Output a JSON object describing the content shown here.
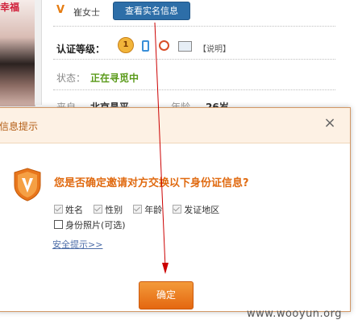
{
  "profile": {
    "photo_caption": "幸福",
    "badge": "V",
    "name": "崔女士",
    "view_button": "查看实名信息",
    "level_label": "认证等级：",
    "medal_value": "1",
    "explain_link": "【说明】",
    "status_label": "状态：",
    "status_value": "正在寻觅中",
    "origin_label": "来自",
    "origin_value": "北京昌平",
    "age_label": "年龄",
    "age_value": "26岁"
  },
  "dialog": {
    "title": "信息提示",
    "close": "×",
    "question": "您是否确定邀请对方交换以下身份证信息?",
    "options": [
      "姓名",
      "性别",
      "年龄",
      "发证地区"
    ],
    "photo_option": "身份照片(可选)",
    "safety_link": "安全提示>>",
    "confirm": "确定"
  },
  "watermark": "www.wooyun.org",
  "colors": {
    "accent_orange": "#e46710",
    "link_blue": "#2d6ea8",
    "status_green": "#5a9a1a",
    "arrow_red": "#cc0000"
  }
}
